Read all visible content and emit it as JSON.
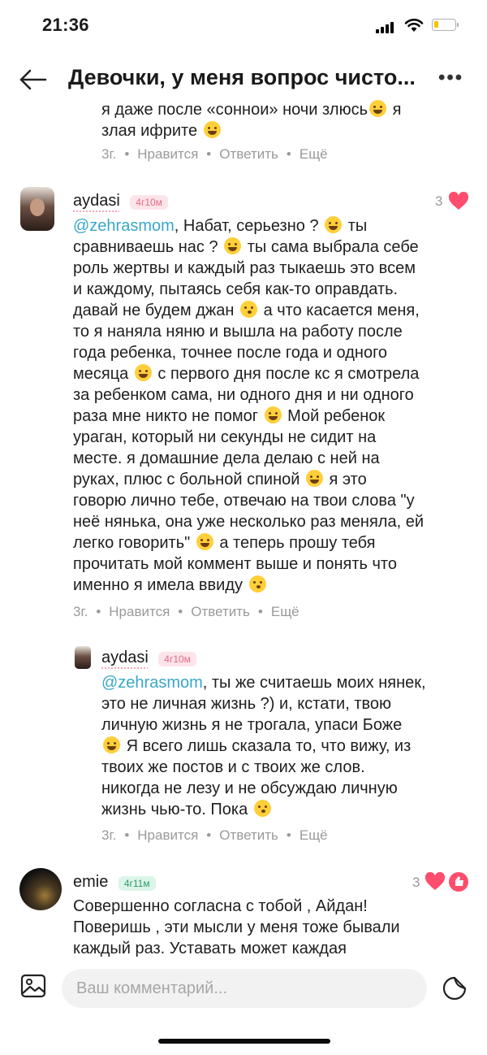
{
  "status_bar": {
    "time": "21:36"
  },
  "header": {
    "title": "Девочки, у меня вопрос чисто..."
  },
  "actions": {
    "reply_time": "3г.",
    "like": "Нравится",
    "reply": "Ответить",
    "more": "Ещё"
  },
  "top_comment": {
    "text_line1": "я даже после «соннои» ночи злюсь",
    "text_line2": "я",
    "text_line3": "злая ифрите"
  },
  "comment1": {
    "username": "aydasi",
    "badge": "4г10м",
    "likes": "3",
    "mention": "@zehrasmom",
    "lines": [
      ", Набат, серьезно ?",
      "ты",
      "сравниваешь нас ?",
      "ты сама выбрала себе",
      "роль жертвы и каждый раз тыкаешь это всем",
      "и каждому, пытаясь себя как-то оправдать.",
      "давай не будем джан",
      "а что касается меня,",
      "то я наняла няню и вышла на работу после",
      "года ребенка, точнее после года и одного",
      "месяца",
      "с первого дня после кс я смотрела",
      "за ребенком сама, ни одного дня и ни одного",
      "раза мне никто не помог",
      "Мой ребенок",
      "ураган, который ни секунды не сидит на",
      "месте. я домашние дела делаю с ней на",
      "руках, плюс с больной спиной",
      "я это",
      "говорю лично тебе, отвечаю на твои слова \"у",
      "неё нянька, она уже несколько раз меняла, ей",
      "легко говорить\"",
      "а теперь прошу тебя",
      "прочитать мой коммент выше и понять что",
      "именно я имела ввиду"
    ]
  },
  "comment2": {
    "username": "aydasi",
    "badge": "4г10м",
    "mention": "@zehrasmom",
    "lines": [
      ", ты же считаешь моих нянек,",
      "это не личная жизнь ?) и, кстати, твою",
      "личную жизнь я не трогала, упаси Боже",
      "Я всего лишь сказала то, что вижу, из",
      "твоих же постов и с твоих же слов.",
      "никогда не лезу и не обсуждаю личную",
      "жизнь чью-то. Пока"
    ]
  },
  "comment3": {
    "username": "emie",
    "badge": "4г11м",
    "likes": "3",
    "lines": [
      "Совершенно согласна с тобой , Айдан!",
      "Поверишь , эти мысли у меня тоже бывали",
      "каждый раз. Уставать может каждая"
    ]
  },
  "composer": {
    "placeholder": "Ваш комментарий..."
  },
  "colors": {
    "mention": "#3aa7c9",
    "heart": "#ff4d6d",
    "badge_pink": "#fde4ea",
    "badge_green": "#dcf5e9"
  }
}
